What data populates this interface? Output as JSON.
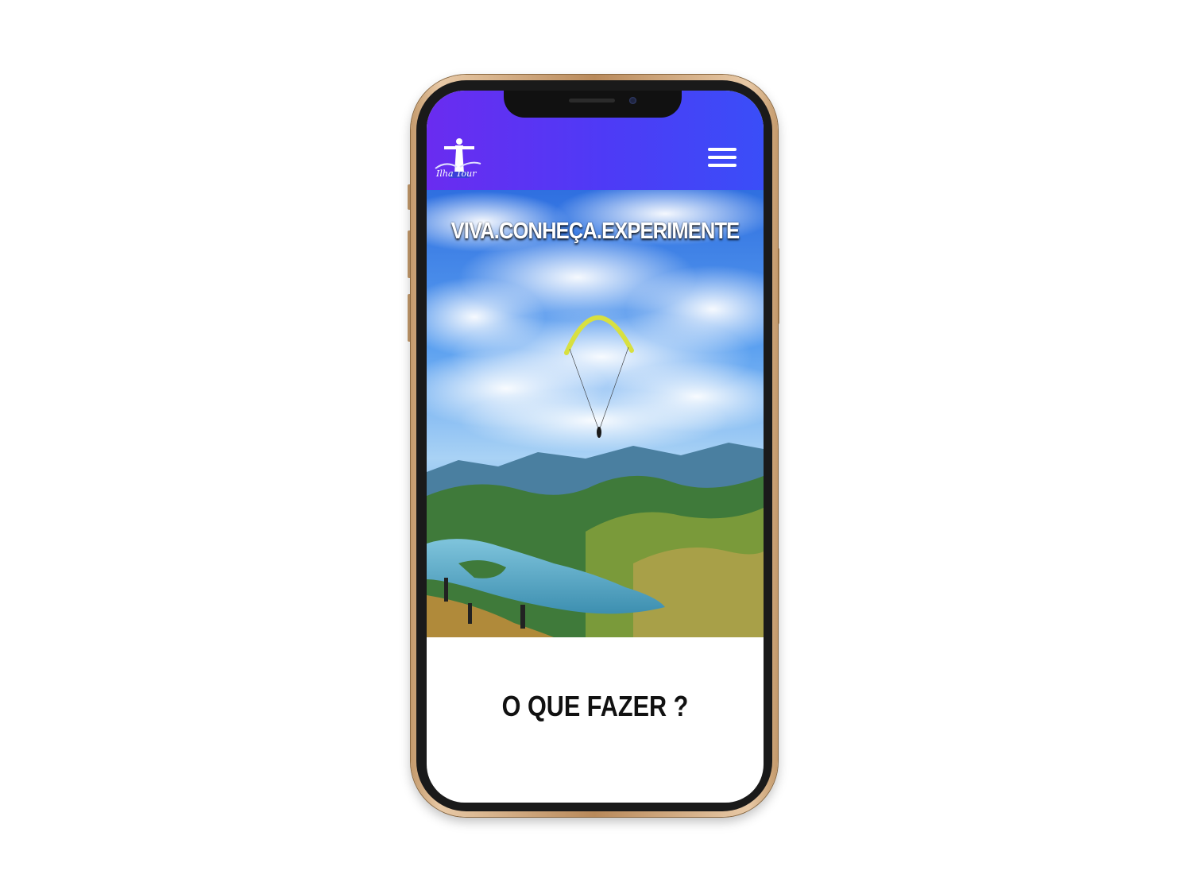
{
  "header": {
    "logo_icon": "cristo-redentor-logo-icon",
    "logo_text": "Ilha Tour",
    "menu_icon": "hamburger-menu-icon",
    "gradient_colors": [
      "#6a2cf0",
      "#3a4ef8"
    ]
  },
  "hero": {
    "title": "VIVA.CONHEÇA.EXPERIMENTE",
    "image_description": "paraglider over lake and mountains"
  },
  "section": {
    "title": "O QUE FAZER ?"
  },
  "device": {
    "frame_color": "#c49a6c"
  }
}
